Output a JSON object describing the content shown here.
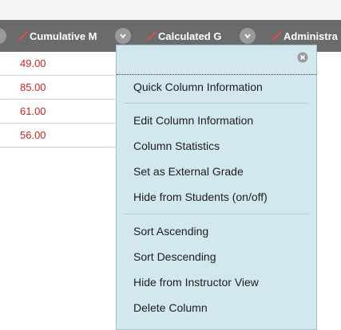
{
  "columns": [
    {
      "label": "Cumulative M"
    },
    {
      "label": "Calculated G"
    },
    {
      "label": "Administra"
    }
  ],
  "rows": [
    "49.00",
    "85.00",
    "61.00",
    "56.00"
  ],
  "menu": {
    "items_group1": [
      "Quick Column Information"
    ],
    "items_group2": [
      "Edit Column Information",
      "Column Statistics",
      "Set as External Grade",
      "Hide from Students (on/off)"
    ],
    "items_group3": [
      "Sort Ascending",
      "Sort Descending",
      "Hide from Instructor View",
      "Delete Column"
    ]
  },
  "colors": {
    "header_bg": "#6b6b6b",
    "menu_bg": "#d3e7ef",
    "value_text": "#cc2222"
  }
}
